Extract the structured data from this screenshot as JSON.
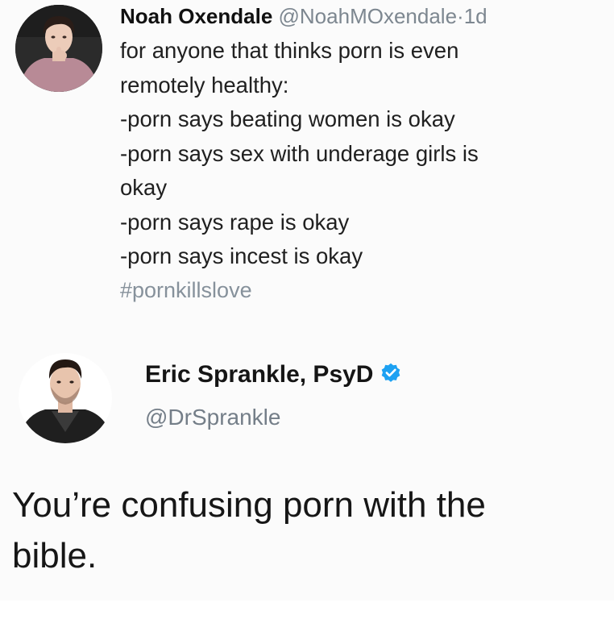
{
  "tweet_1": {
    "author_name": "Noah Oxendale",
    "author_handle": "@NoahMOxendale",
    "separator": "·",
    "age": "1d",
    "text_lines": [
      "for anyone that thinks porn is even",
      "remotely healthy:",
      "-porn says beating women is okay",
      "-porn says sex with underage girls is",
      "okay",
      "-porn says rape is okay",
      "-porn says incest is okay"
    ],
    "hashtag": "#pornkillslove"
  },
  "tweet_2": {
    "author_name": "Eric Sprankle, PsyD",
    "author_handle": "@DrSprankle",
    "verified": true,
    "text_lines": [
      "You’re confusing porn with the",
      "bible."
    ]
  },
  "colors": {
    "background": "#fbfbfb",
    "handle_gray": "#7d8790",
    "hashtag_gray": "#86919b",
    "verified_blue": "#1da1f2"
  }
}
